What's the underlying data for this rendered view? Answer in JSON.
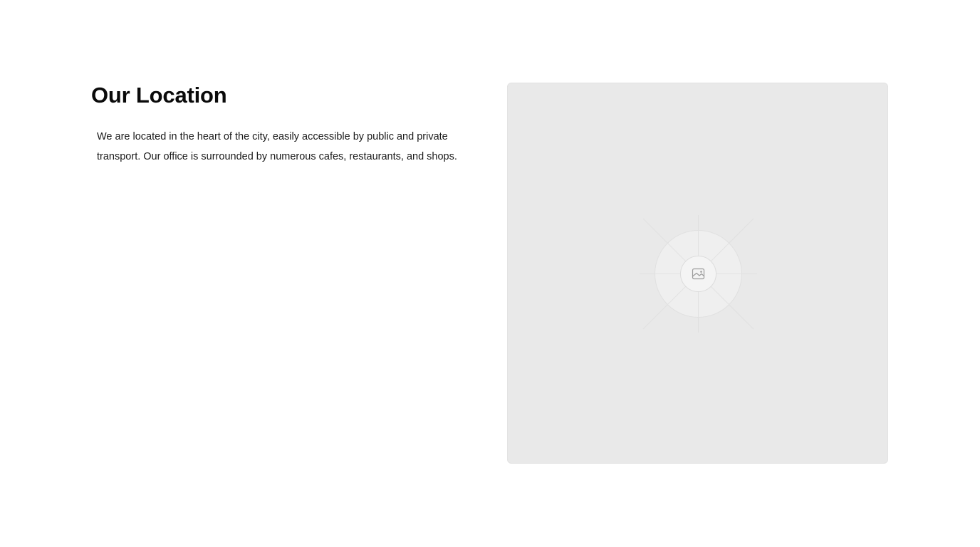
{
  "location": {
    "title": "Our Location",
    "description": "We are located in the heart of the city, easily accessible by public and private transport. Our office is surrounded by numerous cafes, restaurants, and shops."
  },
  "media": {
    "icon": "image-placeholder-icon",
    "colors": {
      "card_background": "#e9e9e9",
      "ring_fill": "#efefef",
      "ring_stroke": "#dedede",
      "icon_stroke": "#9a9a9a"
    }
  }
}
